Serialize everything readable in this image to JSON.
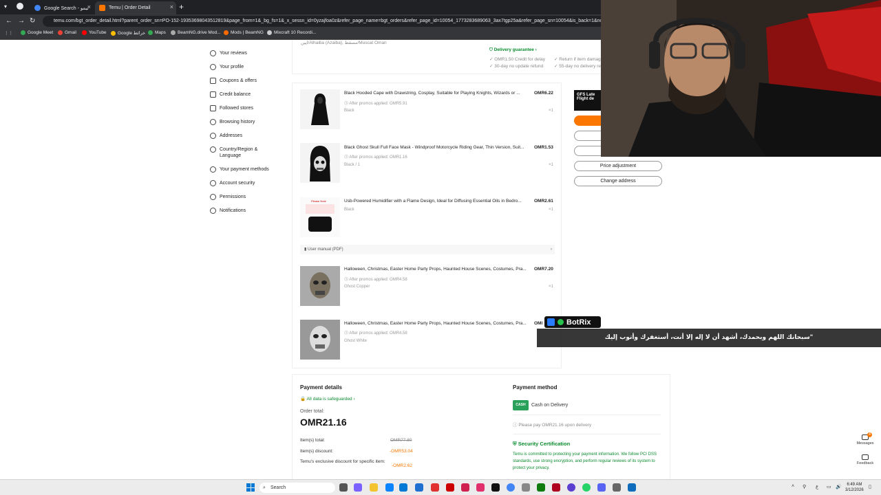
{
  "browser": {
    "tabs": [
      {
        "label": "Google Search - تيمو",
        "favicon_color": "#4285f4"
      },
      {
        "label": "Temu | Order Detail",
        "favicon_color": "#fb7701"
      }
    ],
    "url": "temu.com/bgt_order_detail.html?parent_order_sn=PO-152-19353698043512819&page_from=1&_bg_fs=1&_x_sessn_id=0yzajfoa0z&refer_page_name=bgt_orders&refer_page_id=10054_1773283689063_3ax7tgp25a&refer_page_sn=10054&is_back=1&no_ca",
    "bookmarks": [
      {
        "label": "Google Meet",
        "color": "#34a853"
      },
      {
        "label": "Gmail",
        "color": "#ea4335"
      },
      {
        "label": "YouTube",
        "color": "#ff0000"
      },
      {
        "label": "Google خرائط",
        "color": "#fbbc04"
      },
      {
        "label": "Maps",
        "color": "#34a853"
      },
      {
        "label": "BeamNG.drive Mod...",
        "color": "#aaaaaa"
      },
      {
        "label": "Mods | BeamNG",
        "color": "#ff6a00"
      },
      {
        "label": "Mixcraft 10 Recordi...",
        "color": "#cccccc"
      }
    ]
  },
  "sidebar": {
    "items": [
      {
        "label": "Your reviews"
      },
      {
        "label": "Your profile"
      },
      {
        "label": "Coupons & offers"
      },
      {
        "label": "Credit balance"
      },
      {
        "label": "Followed stores"
      },
      {
        "label": "Browsing history"
      },
      {
        "label": "Addresses"
      },
      {
        "label": "Country/Region & Language"
      },
      {
        "label": "Your payment methods"
      },
      {
        "label": "Account security"
      },
      {
        "label": "Permissions"
      },
      {
        "label": "Notifications"
      }
    ]
  },
  "shipping": {
    "address_partial": "ايين/Alhaiba (Azaiba), مسقط/Muscat Oman",
    "delivery_guarantee": "Delivery guarantee",
    "credit_for_delay": "OMR1.50 Credit for delay",
    "no_update_refund": "30-day no update refund",
    "return_if_damaged": "Return if item damage",
    "no_delivery_refund": "55-day no delivery ref"
  },
  "items": [
    {
      "title": "Black Hooded Cape with Drawstring, Cosplay, Suitable for Playing Knights, Wizards or ...",
      "promo": "After promos applied: OMR5.91",
      "variant": "Black",
      "price": "OMR6.22",
      "qty": "×1"
    },
    {
      "title": "Black Ghost Skull Full Face Mask - Windproof Motorcycle Riding Gear, Thin Version, Suit...",
      "promo": "After promos applied: OMR1.16",
      "variant": "Black / 1",
      "price": "OMR1.53",
      "qty": "×1"
    },
    {
      "title": "Usb-Powered Humidifier with a Flame Design, Ideal for Diffusing Essential Oils in Bedro...",
      "promo": "",
      "variant": "Black",
      "price": "OMR2.61",
      "qty": "×1",
      "manual": "User manual (PDF)",
      "thumb_text": "Please Note"
    },
    {
      "title": "Halloween, Christmas, Easter Home Party Props, Haunted House Scenes, Costumes, Pra...",
      "promo": "After promos applied: OMR4.58",
      "variant": "Ghost Copper",
      "price": "OMR7.20",
      "qty": "×1"
    },
    {
      "title": "Halloween, Christmas, Easter Home Party Props, Haunted House Scenes, Costumes, Pra...",
      "promo": "After promos applied: OMR4.58",
      "variant": "Ghost White",
      "price": "OMI",
      "qty": ""
    }
  ],
  "side_actions": {
    "gfs_label": "GFS Late",
    "flight_label": "Flight de",
    "price_adjustment": "Price adjustment",
    "change_address": "Change address"
  },
  "payment_details": {
    "title": "Payment details",
    "safeguarded": "All data is safeguarded",
    "order_total_label": "Order total:",
    "order_total": "OMR21.16",
    "items_total_label": "Item(s) total:",
    "items_total": "OMR77.80",
    "items_discount_label": "Item(s) discount:",
    "items_discount": "-OMR53.04",
    "exclusive_discount_label": "Temu's exclusive discount for specific item:",
    "exclusive_discount": "-OMR2.62"
  },
  "payment_method": {
    "title": "Payment method",
    "cash_badge": "CASH",
    "method": "Cash on Delivery",
    "note": "Please pay OMR21.16 upon delivery",
    "security_title": "Security Certification",
    "security_text": "Temu is committed to protecting your payment information. We follow PCI DSS standards, use strong encryption, and perform regular reviews of its system to protect your privacy."
  },
  "overlay": {
    "botrix_label": "BotRix",
    "botrix_message": "\"سبحانك اللهم وبحمدك، أشهد أن لا إله إلا أنت، أستغفرك وأتوب إليك"
  },
  "right_panel": {
    "messages": "Messages",
    "messages_badge": "4",
    "feedback": "Feedback"
  },
  "taskbar": {
    "search": "Search",
    "time": "6:49 AM",
    "date": "3/12/2026",
    "lang": "ع"
  }
}
